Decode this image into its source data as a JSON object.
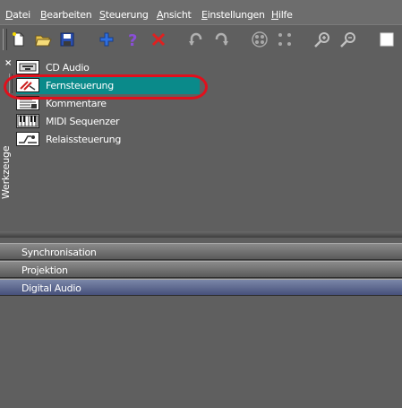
{
  "menu": {
    "items": [
      "Datei",
      "Bearbeiten",
      "Steuerung",
      "Ansicht",
      "Einstellungen",
      "Hilfe"
    ]
  },
  "toolbar": {
    "buttons": [
      {
        "icon": "new-document-icon"
      },
      {
        "icon": "open-folder-icon"
      },
      {
        "icon": "save-icon"
      },
      {
        "icon": "add-icon"
      },
      {
        "icon": "help-icon"
      },
      {
        "icon": "delete-icon"
      },
      {
        "icon": "undo-icon"
      },
      {
        "icon": "redo-icon"
      },
      {
        "icon": "group-icon"
      },
      {
        "icon": "ungroup-icon"
      },
      {
        "icon": "zoom-in-icon"
      },
      {
        "icon": "zoom-out-icon"
      },
      {
        "icon": "checkbox-icon"
      }
    ]
  },
  "tools_panel": {
    "close_label": "×",
    "vertical_label": "Werkzeuge",
    "items": [
      {
        "label": "CD Audio",
        "icon": "cd-audio-icon"
      },
      {
        "label": "Fernsteuerung",
        "icon": "remote-control-icon",
        "selected": true
      },
      {
        "label": "Kommentare",
        "icon": "comments-icon"
      },
      {
        "label": "MIDI Sequenzer",
        "icon": "midi-sequencer-icon"
      },
      {
        "label": "Relaissteuerung",
        "icon": "relay-control-icon"
      }
    ]
  },
  "sections": [
    {
      "label": "Synchronisation"
    },
    {
      "label": "Projektion"
    },
    {
      "label": "Digital Audio",
      "active": true
    }
  ],
  "colors": {
    "background": "#5f5f5f",
    "selection": "#0a8a8a",
    "highlight_ring": "#e0101c",
    "active_section": "#5a6690"
  }
}
